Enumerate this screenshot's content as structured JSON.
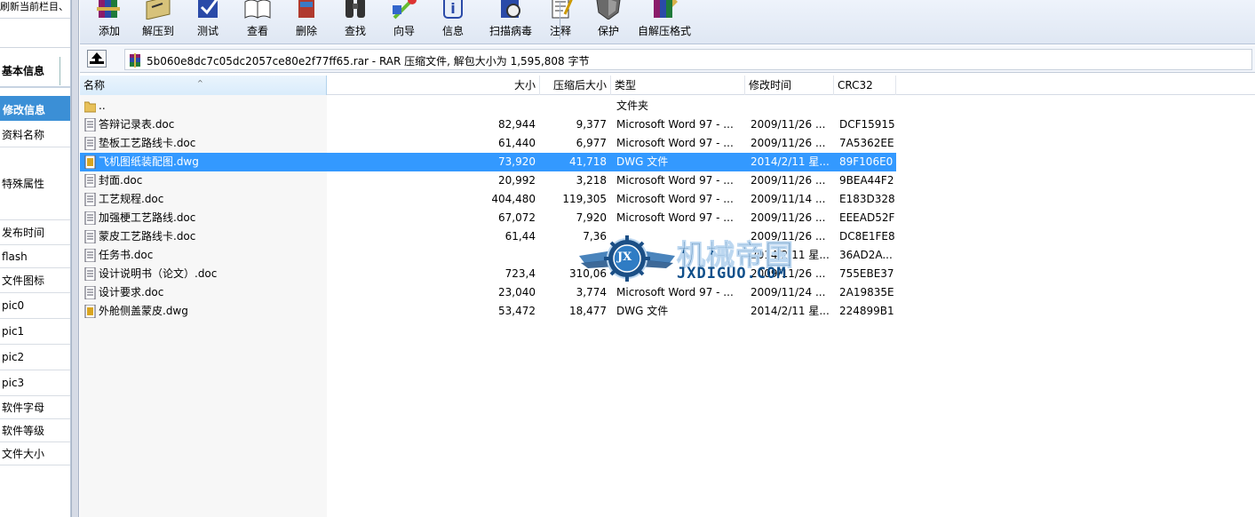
{
  "left_panel": {
    "top_text": "刷新当前栏目、",
    "tab_basic": "基本信息",
    "tab_edit": "修改信息",
    "fields": [
      "资料名称",
      "特殊属性",
      "发布时间",
      "flash",
      "文件图标",
      "pic0",
      "pic1",
      "pic2",
      "pic3",
      "软件字母",
      "软件等级",
      "文件大小"
    ]
  },
  "toolbar": {
    "buttons": [
      {
        "label": "添加",
        "icon": "books-add-icon"
      },
      {
        "label": "解压到",
        "icon": "extract-to-icon"
      },
      {
        "label": "测试",
        "icon": "test-icon"
      },
      {
        "label": "查看",
        "icon": "view-book-icon"
      },
      {
        "label": "删除",
        "icon": "delete-icon"
      },
      {
        "label": "查找",
        "icon": "binoculars-icon"
      },
      {
        "label": "向导",
        "icon": "wizard-icon"
      },
      {
        "label": "信息",
        "icon": "info-icon"
      },
      {
        "label": "扫描病毒",
        "icon": "virus-scan-icon"
      },
      {
        "label": "注释",
        "icon": "comment-icon"
      },
      {
        "label": "保护",
        "icon": "shield-icon"
      },
      {
        "label": "自解压格式",
        "icon": "sfx-icon"
      }
    ]
  },
  "path": {
    "text": "5b060e8dc7c05dc2057ce80e2f77ff65.rar - RAR 压缩文件, 解包大小为 1,595,808 字节"
  },
  "columns": {
    "name": "名称",
    "size": "大小",
    "packed": "压缩后大小",
    "type": "类型",
    "modified": "修改时间",
    "crc": "CRC32"
  },
  "files": [
    {
      "name": "..",
      "size": "",
      "packed": "",
      "type": "文件夹",
      "modified": "",
      "crc": "",
      "kind": "folder"
    },
    {
      "name": "答辩记录表.doc",
      "size": "82,944",
      "packed": "9,377",
      "type": "Microsoft Word 97 - ...",
      "modified": "2009/11/26 ...",
      "crc": "DCF15915",
      "kind": "doc"
    },
    {
      "name": "垫板工艺路线卡.doc",
      "size": "61,440",
      "packed": "6,977",
      "type": "Microsoft Word 97 - ...",
      "modified": "2009/11/26 ...",
      "crc": "7A5362EE",
      "kind": "doc"
    },
    {
      "name": "飞机图纸装配图.dwg",
      "size": "73,920",
      "packed": "41,718",
      "type": "DWG 文件",
      "modified": "2014/2/11 星...",
      "crc": "89F106E0",
      "kind": "dwg",
      "selected": true
    },
    {
      "name": "封面.doc",
      "size": "20,992",
      "packed": "3,218",
      "type": "Microsoft Word 97 - ...",
      "modified": "2009/11/26 ...",
      "crc": "9BEA44F2",
      "kind": "doc"
    },
    {
      "name": "工艺规程.doc",
      "size": "404,480",
      "packed": "119,305",
      "type": "Microsoft Word 97 - ...",
      "modified": "2009/11/14 ...",
      "crc": "E183D328",
      "kind": "doc"
    },
    {
      "name": "加强梗工艺路线.doc",
      "size": "67,072",
      "packed": "7,920",
      "type": "Microsoft Word 97 - ...",
      "modified": "2009/11/26 ...",
      "crc": "EEEAD52F",
      "kind": "doc"
    },
    {
      "name": "蒙皮工艺路线卡.doc",
      "size": "61,44",
      "packed": "7,36",
      "type": "",
      "modified": "2009/11/26 ...",
      "crc": "DC8E1FE8",
      "kind": "doc"
    },
    {
      "name": "任务书.doc",
      "size": "",
      "packed": "",
      "type": "",
      "modified": "2014/2/11 星...",
      "crc": "36AD2A...",
      "kind": "doc"
    },
    {
      "name": "设计说明书（论文）.doc",
      "size": "723,4",
      "packed": "310,06",
      "type": "",
      "modified": "2009/11/26 ...",
      "crc": "755EBE37",
      "kind": "doc"
    },
    {
      "name": "设计要求.doc",
      "size": "23,040",
      "packed": "3,774",
      "type": "Microsoft Word 97 - ...",
      "modified": "2009/11/24 ...",
      "crc": "2A19835E",
      "kind": "doc"
    },
    {
      "name": "外舱侧盖蒙皮.dwg",
      "size": "53,472",
      "packed": "18,477",
      "type": "DWG 文件",
      "modified": "2014/2/11 星...",
      "crc": "224899B1",
      "kind": "dwg"
    }
  ],
  "watermark": {
    "title": "机械帝国",
    "url": "JXDIGUO.COM",
    "badge": "JX"
  },
  "colors": {
    "selection": "#3399ff",
    "edit_tab": "#3b8fd6",
    "watermark": "#0f4f8a"
  }
}
